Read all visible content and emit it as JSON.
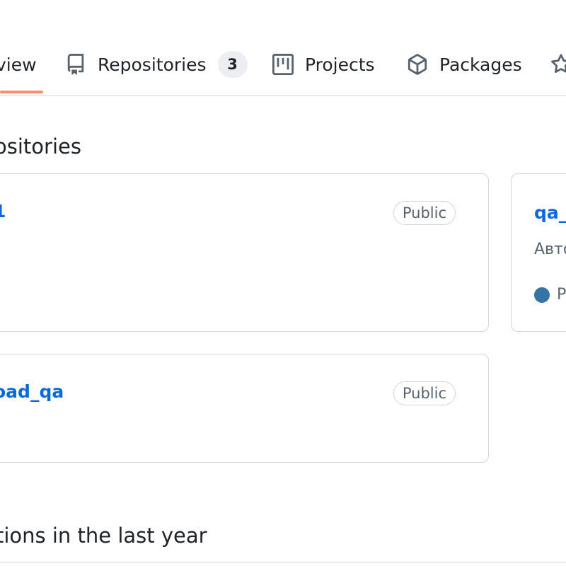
{
  "tabs": {
    "overview": {
      "label": "view"
    },
    "repositories": {
      "label": "Repositories",
      "count": "3"
    },
    "projects": {
      "label": "Projects"
    },
    "packages": {
      "label": "Packages"
    }
  },
  "pinned": {
    "title": "ositories",
    "repos": [
      {
        "name": "1",
        "visibility": "Public"
      },
      {
        "name": "oad_qa",
        "visibility": "Public"
      },
      {
        "name": "qa_",
        "description": "Авто",
        "language": "Py",
        "language_color": "#3572A5"
      }
    ]
  },
  "contributions": {
    "title": "tions in the last year"
  },
  "colors": {
    "link": "#0969da",
    "underline": "#fd8c73",
    "border": "#d0d7de"
  },
  "icons": [
    "repo-icon",
    "project-icon",
    "package-icon",
    "star-icon"
  ]
}
